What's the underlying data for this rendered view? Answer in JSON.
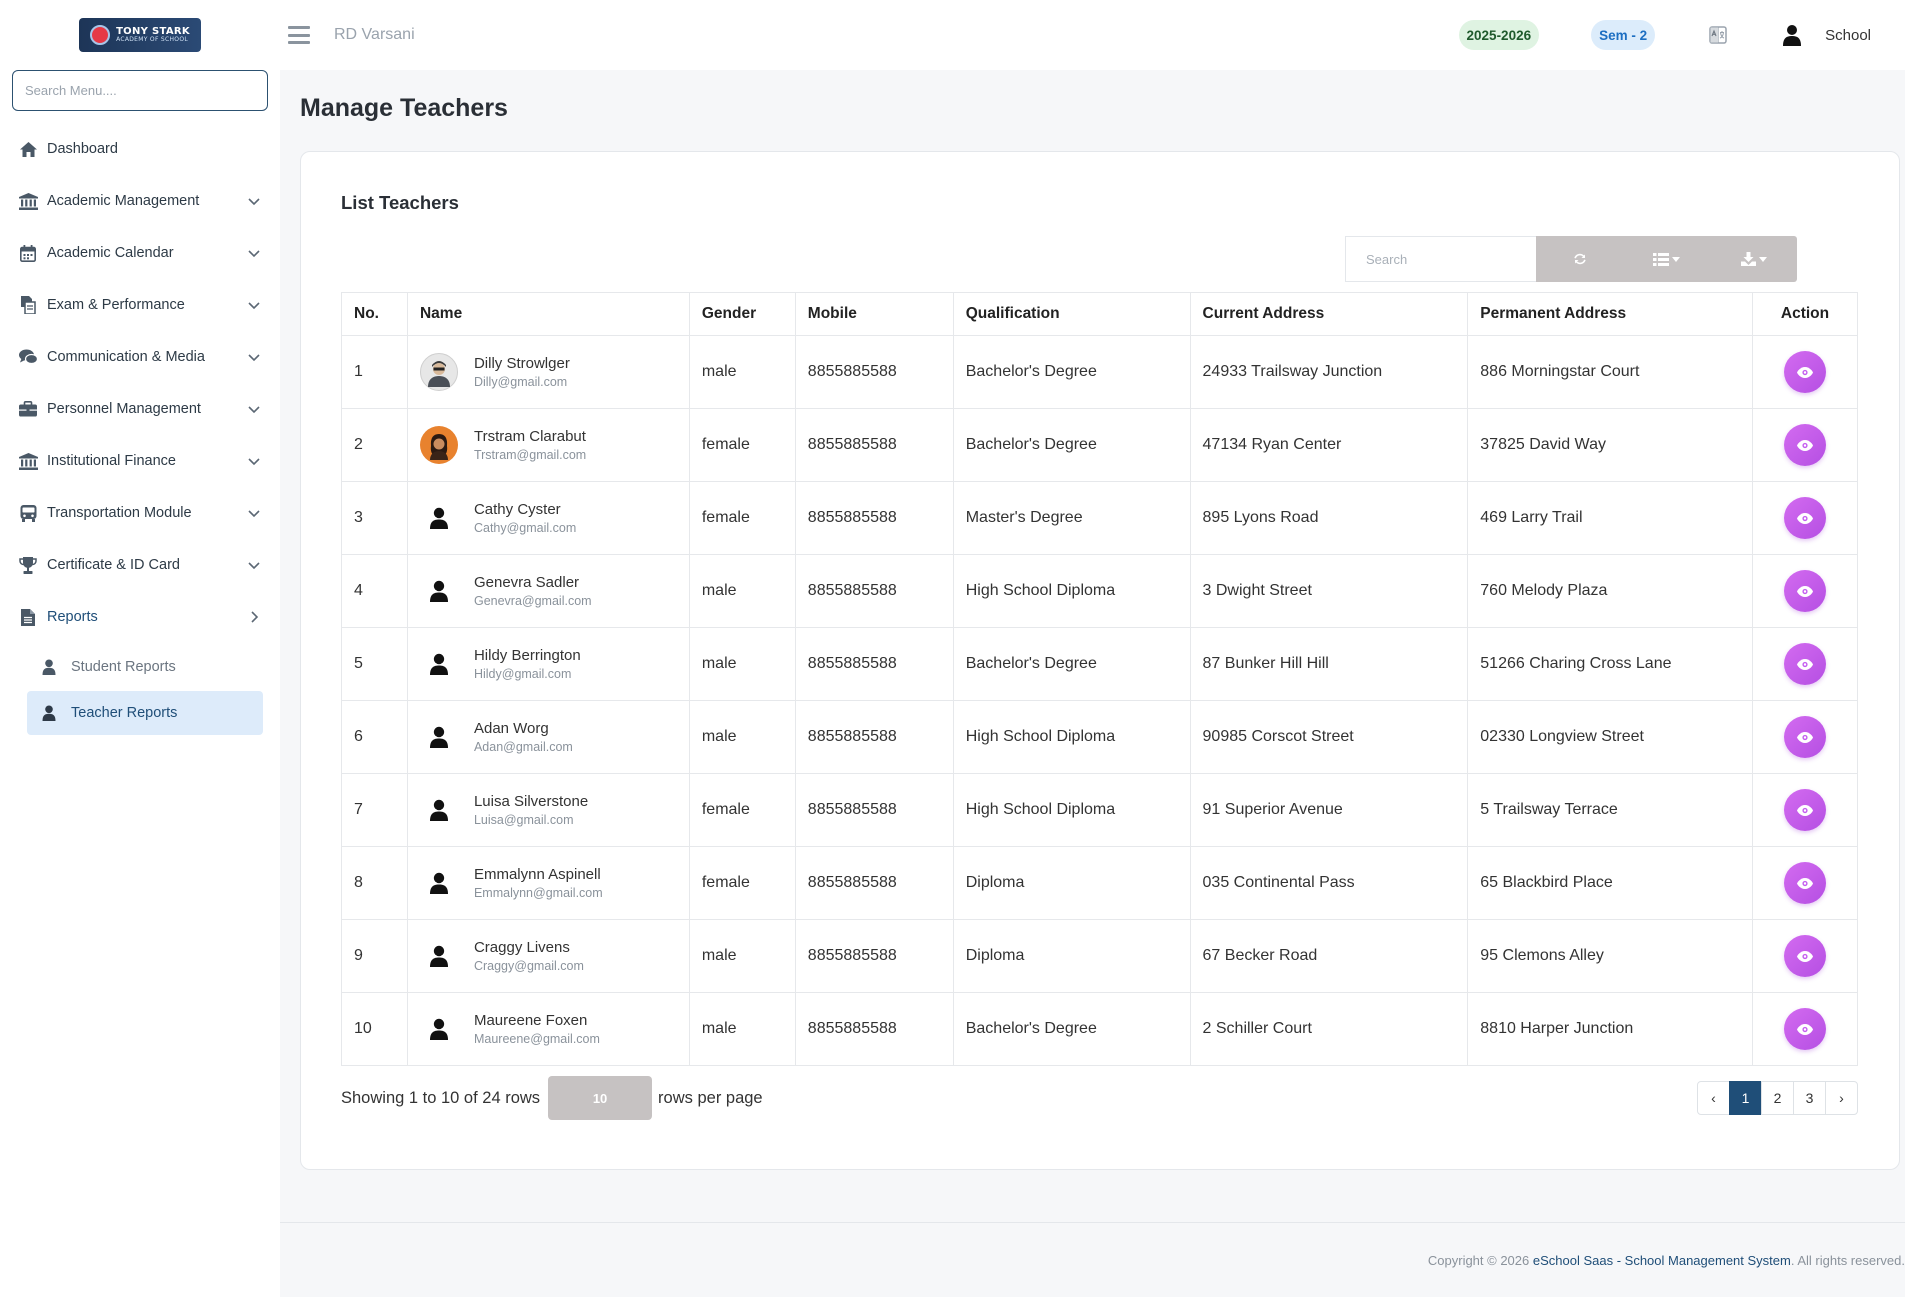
{
  "sidebar": {
    "logo_text": "TONY STARK",
    "logo_subtext": "ACADEMY OF SCHOOL",
    "search_placeholder": "Search Menu....",
    "menu": [
      {
        "label": "Dashboard",
        "icon": "home-icon",
        "has_children": false
      },
      {
        "label": "Academic Management",
        "icon": "institution-icon",
        "has_children": true
      },
      {
        "label": "Academic Calendar",
        "icon": "calendar-icon",
        "has_children": true
      },
      {
        "label": "Exam & Performance",
        "icon": "exam-icon",
        "has_children": true
      },
      {
        "label": "Communication & Media",
        "icon": "chat-icon",
        "has_children": true
      },
      {
        "label": "Personnel Management",
        "icon": "briefcase-icon",
        "has_children": true
      },
      {
        "label": "Institutional Finance",
        "icon": "institution-icon",
        "has_children": true
      },
      {
        "label": "Transportation Module",
        "icon": "bus-icon",
        "has_children": true
      },
      {
        "label": "Certificate & ID Card",
        "icon": "trophy-icon",
        "has_children": true
      },
      {
        "label": "Reports",
        "icon": "file-icon",
        "has_children": true,
        "expanded": true
      }
    ],
    "reports_submenu": [
      {
        "label": "Student Reports",
        "icon": "user-icon",
        "active": false
      },
      {
        "label": "Teacher Reports",
        "icon": "user-icon",
        "active": true
      }
    ]
  },
  "header": {
    "org_name": "RD Varsani",
    "session": "2025-2026",
    "semester": "Sem - 2",
    "user_label": "School"
  },
  "page": {
    "title": "Manage Teachers",
    "card_title": "List Teachers",
    "search_placeholder": "Search"
  },
  "table": {
    "columns": [
      "No.",
      "Name",
      "Gender",
      "Mobile",
      "Qualification",
      "Current Address",
      "Permanent Address",
      "Action"
    ],
    "rows": [
      {
        "no": "1",
        "name": "Dilly Strowlger",
        "email": "Dilly@gmail.com",
        "gender": "male",
        "mobile": "8855885588",
        "qualification": "Bachelor's Degree",
        "current_address": "24933 Trailsway Junction",
        "permanent_address": "886 Morningstar Court",
        "avatar": "photo1"
      },
      {
        "no": "2",
        "name": "Trstram Clarabut",
        "email": "Trstram@gmail.com",
        "gender": "female",
        "mobile": "8855885588",
        "qualification": "Bachelor's Degree",
        "current_address": "47134 Ryan Center",
        "permanent_address": "37825 David Way",
        "avatar": "photo2"
      },
      {
        "no": "3",
        "name": "Cathy Cyster",
        "email": "Cathy@gmail.com",
        "gender": "female",
        "mobile": "8855885588",
        "qualification": "Master's Degree",
        "current_address": "895 Lyons Road",
        "permanent_address": "469 Larry Trail",
        "avatar": "plain"
      },
      {
        "no": "4",
        "name": "Genevra Sadler",
        "email": "Genevra@gmail.com",
        "gender": "male",
        "mobile": "8855885588",
        "qualification": "High School Diploma",
        "current_address": "3 Dwight Street",
        "permanent_address": "760 Melody Plaza",
        "avatar": "plain"
      },
      {
        "no": "5",
        "name": "Hildy Berrington",
        "email": "Hildy@gmail.com",
        "gender": "male",
        "mobile": "8855885588",
        "qualification": "Bachelor's Degree",
        "current_address": "87 Bunker Hill Hill",
        "permanent_address": "51266 Charing Cross Lane",
        "avatar": "plain"
      },
      {
        "no": "6",
        "name": "Adan Worg",
        "email": "Adan@gmail.com",
        "gender": "male",
        "mobile": "8855885588",
        "qualification": "High School Diploma",
        "current_address": "90985 Corscot Street",
        "permanent_address": "02330 Longview Street",
        "avatar": "plain"
      },
      {
        "no": "7",
        "name": "Luisa Silverstone",
        "email": "Luisa@gmail.com",
        "gender": "female",
        "mobile": "8855885588",
        "qualification": "High School Diploma",
        "current_address": "91 Superior Avenue",
        "permanent_address": "5 Trailsway Terrace",
        "avatar": "plain"
      },
      {
        "no": "8",
        "name": "Emmalynn Aspinell",
        "email": "Emmalynn@gmail.com",
        "gender": "female",
        "mobile": "8855885588",
        "qualification": "Diploma",
        "current_address": "035 Continental Pass",
        "permanent_address": "65 Blackbird Place",
        "avatar": "plain"
      },
      {
        "no": "9",
        "name": "Craggy Livens",
        "email": "Craggy@gmail.com",
        "gender": "male",
        "mobile": "8855885588",
        "qualification": "Diploma",
        "current_address": "67 Becker Road",
        "permanent_address": "95 Clemons Alley",
        "avatar": "plain"
      },
      {
        "no": "10",
        "name": "Maureene Foxen",
        "email": "Maureene@gmail.com",
        "gender": "male",
        "mobile": "8855885588",
        "qualification": "Bachelor's Degree",
        "current_address": "2 Schiller Court",
        "permanent_address": "8810 Harper Junction",
        "avatar": "plain"
      }
    ]
  },
  "pagination": {
    "summary": "Showing 1 to 10 of 24 rows",
    "rows_per_page": "10",
    "rows_per_page_label": "rows per page",
    "prev": "‹",
    "next": "›",
    "pages": [
      "1",
      "2",
      "3"
    ],
    "current_page": "1"
  },
  "footer": {
    "prefix": "Copyright © 2026 ",
    "link": "eSchool Saas - School Management System",
    "suffix": ". All rights reserved."
  },
  "colors": {
    "primary": "#1f4e78",
    "action_button": "#c55ff0",
    "toolbar_button": "#c6c2c2",
    "session_pill_bg": "#dff3e2",
    "semester_pill_bg": "#dcecfb"
  }
}
